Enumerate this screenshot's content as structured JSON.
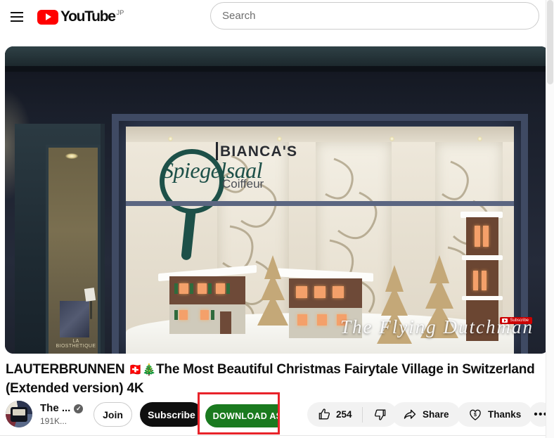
{
  "masthead": {
    "menu_icon": "hamburger-menu-icon",
    "logo_text": "YouTube",
    "logo_country_code": "JP",
    "play_icon": "youtube-play-icon"
  },
  "search": {
    "placeholder": "Search",
    "value": ""
  },
  "video": {
    "title": "LAUTERBRUNNEN 🇨🇭🎄The Most Beautiful Christmas Fairytale Village in Switzerland (Extended version) 4K",
    "title_line_1": "LAUTERBRUNNEN",
    "title_emoji_flag": "🇨🇭",
    "title_emoji_tree": "🎄",
    "title_rest": "The Most Beautiful Christmas Fairytale Village in Switzerland (Extended version) 4K",
    "watermark": "The Flying Dutchman",
    "watermark_subscribe": "Subscribe",
    "shop_sign_name": "BIANCA'S",
    "shop_sign_brand": "Spiegelsaal",
    "shop_sign_type": "Coiffeur",
    "door_poster_text": "LA BIOSTHETIQUE"
  },
  "channel": {
    "name": "The ...",
    "subscribers": "191K...",
    "verified_glyph": "✓",
    "avatar_name": "channel-avatar"
  },
  "buttons": {
    "join": "Join",
    "subscribe": "Subscribe",
    "download_as": "DOWNLOAD AS",
    "share": "Share",
    "thanks": "Thanks",
    "more": "•••"
  },
  "engagement": {
    "like_count": "254",
    "like_icon": "thumbs-up-icon",
    "dislike_icon": "thumbs-down-icon",
    "share_icon": "share-arrow-icon",
    "thanks_icon": "heart-dollar-icon"
  },
  "colors": {
    "brand_red": "#ff0000",
    "highlight_red": "#e8232a",
    "download_green": "#1a7a1f",
    "subscribe_black": "#0f0f0f",
    "chip_grey": "#f2f2f2"
  }
}
